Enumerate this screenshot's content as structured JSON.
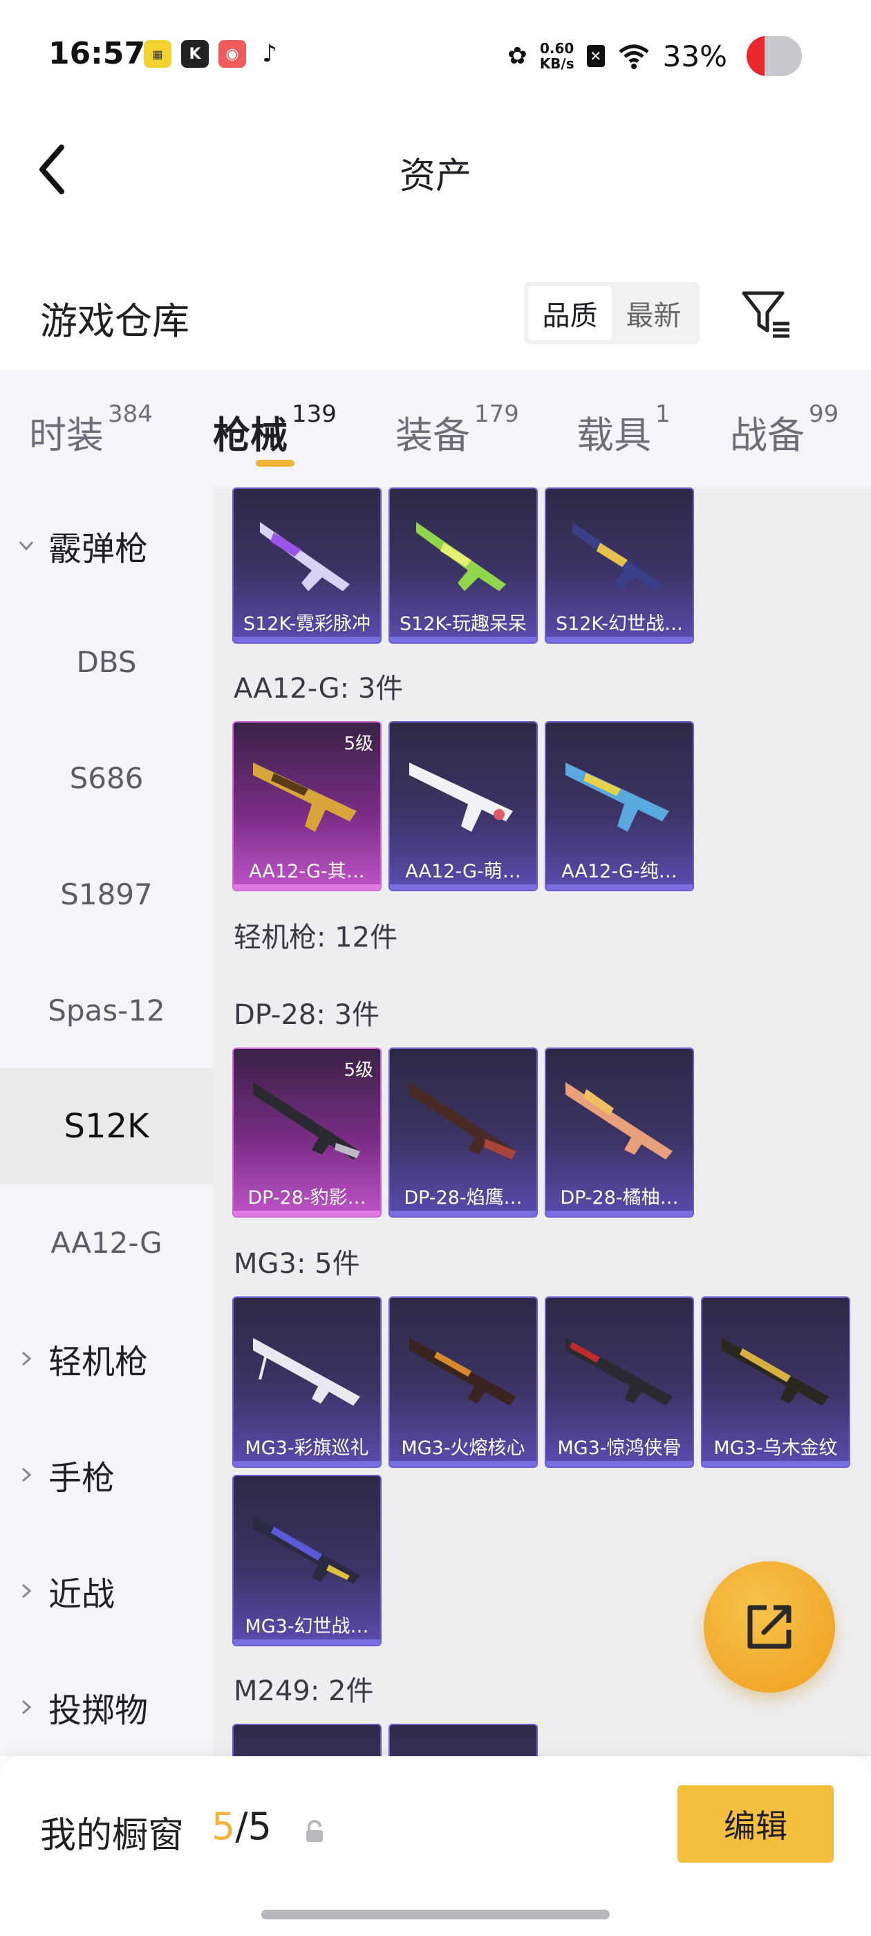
{
  "status_bar": {
    "time": "16:57",
    "net_speed_value": "0.60",
    "net_speed_unit": "KB/s",
    "battery": "33%",
    "apps": [
      "app-icon-1",
      "k-app-icon",
      "camera-app-icon",
      "tiktok-icon"
    ]
  },
  "header": {
    "title": "资产"
  },
  "warehouse": {
    "title": "游戏仓库",
    "sort_quality": "品质",
    "sort_latest": "最新",
    "active_sort": "品质"
  },
  "tabs": [
    {
      "label": "时装",
      "count": "384"
    },
    {
      "label": "枪械",
      "count": "139"
    },
    {
      "label": "装备",
      "count": "179"
    },
    {
      "label": "载具",
      "count": "1"
    },
    {
      "label": "战备",
      "count": "99"
    }
  ],
  "active_tab": "枪械",
  "sidebar": {
    "items": [
      {
        "label": "霰弹枪",
        "type": "group",
        "expanded": true
      },
      {
        "label": "DBS",
        "type": "sub"
      },
      {
        "label": "S686",
        "type": "sub"
      },
      {
        "label": "S1897",
        "type": "sub"
      },
      {
        "label": "Spas-12",
        "type": "sub"
      },
      {
        "label": "S12K",
        "type": "sub",
        "selected": true
      },
      {
        "label": "AA12-G",
        "type": "sub"
      },
      {
        "label": "轻机枪",
        "type": "group"
      },
      {
        "label": "手枪",
        "type": "group"
      },
      {
        "label": "近战",
        "type": "group"
      },
      {
        "label": "投掷物",
        "type": "group"
      }
    ]
  },
  "content": {
    "s12k_cards": [
      {
        "name": "S12K-霓彩脉冲",
        "rarity": "purple"
      },
      {
        "name": "S12K-玩趣呆呆",
        "rarity": "purple"
      },
      {
        "name": "S12K-幻世战…",
        "rarity": "purple"
      }
    ],
    "aa12g_header": "AA12-G: 3件",
    "aa12g_cards": [
      {
        "name": "AA12-G-其…",
        "rarity": "pink",
        "level": "5级"
      },
      {
        "name": "AA12-G-萌…",
        "rarity": "purple"
      },
      {
        "name": "AA12-G-纯…",
        "rarity": "purple"
      }
    ],
    "lmg_header": "轻机枪: 12件",
    "dp28_header": "DP-28: 3件",
    "dp28_cards": [
      {
        "name": "DP-28-豹影…",
        "rarity": "pink",
        "level": "5级"
      },
      {
        "name": "DP-28-焰鹰…",
        "rarity": "purple"
      },
      {
        "name": "DP-28-橘柚…",
        "rarity": "purple"
      }
    ],
    "mg3_header": "MG3: 5件",
    "mg3_cards": [
      {
        "name": "MG3-彩旗巡礼",
        "rarity": "purple"
      },
      {
        "name": "MG3-火熔核心",
        "rarity": "purple"
      },
      {
        "name": "MG3-惊鸿侠骨",
        "rarity": "purple"
      },
      {
        "name": "MG3-乌木金纹",
        "rarity": "purple"
      },
      {
        "name": "MG3-幻世战…",
        "rarity": "purple"
      }
    ],
    "m249_header": "M249: 2件"
  },
  "showcase": {
    "title": "我的橱窗",
    "current": "5",
    "separator": "/",
    "total": "5",
    "edit_label": "编辑"
  },
  "colors": {
    "accent": "#f2b53a",
    "edit_button": "#f4bf3d",
    "purple_rarity": "#6b5fd2",
    "pink_rarity": "#d06ad8"
  }
}
